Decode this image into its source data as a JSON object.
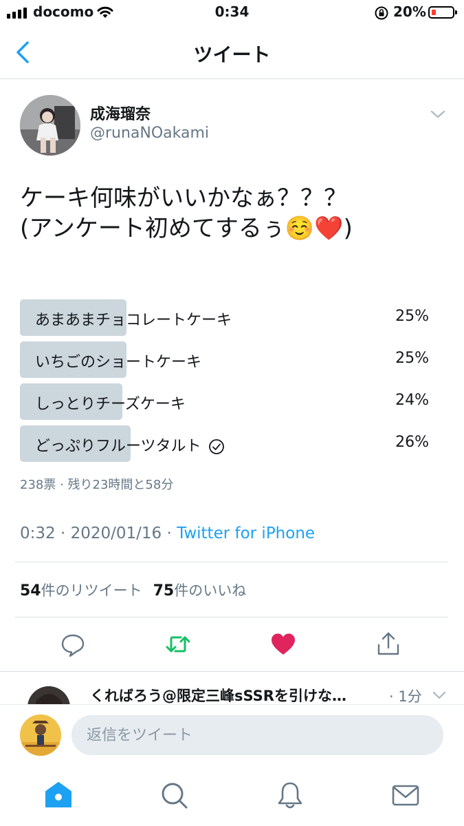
{
  "status_bar": {
    "carrier": "docomo",
    "time": "0:34",
    "battery_percent": "20%",
    "battery_level": 0.2,
    "battery_color": "#ff3b30"
  },
  "nav": {
    "title": "ツイート",
    "back_icon": "chevron-left-icon"
  },
  "tweet": {
    "author_name": "成海瑠奈",
    "author_handle": "@runaNOakami",
    "text_lines": [
      "ケーキ何味がいいかなぁ？？？",
      "(アンケート初めてするぅ☺️❤️)"
    ],
    "timestamp": "0:32 · 2020/01/16 · ",
    "source": "Twitter for iPhone"
  },
  "poll": {
    "options": [
      {
        "label": "あまあまチョコレートケーキ",
        "percent": "25%",
        "share": 0.25,
        "selected": false
      },
      {
        "label": "いちごのショートケーキ",
        "percent": "25%",
        "share": 0.25,
        "selected": false
      },
      {
        "label": "しっとりチーズケーキ",
        "percent": "24%",
        "share": 0.24,
        "selected": false
      },
      {
        "label": "どっぷりフルーツタルト",
        "percent": "26%",
        "share": 0.26,
        "selected": true
      }
    ],
    "meta": "238票 · 残り23時間と58分"
  },
  "stats": {
    "retweet_count": "54",
    "retweet_label": "件のリツイート",
    "like_count": "75",
    "like_label": "件のいいね"
  },
  "actions": {
    "reply_icon": "speech-bubble-icon",
    "retweet_icon": "retweet-icon",
    "like_icon": "heart-icon",
    "share_icon": "share-icon",
    "retweet_color": "#17bf63",
    "like_color": "#e0245e"
  },
  "reply_preview": {
    "name": "くればろう@限定三峰sSSRを引けな…",
    "time": "· 1分"
  },
  "compose": {
    "placeholder": "返信をツイート"
  },
  "tab_bar": {
    "accent": "#1da1f2",
    "items": [
      "home-icon",
      "search-icon",
      "bell-icon",
      "mail-icon"
    ]
  }
}
